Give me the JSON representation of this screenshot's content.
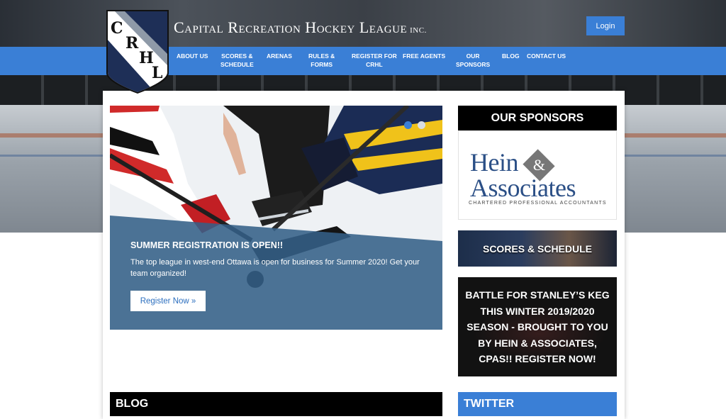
{
  "site": {
    "title": "Capital Recreation Hockey League",
    "title_suffix": "INC.",
    "logo_letters": [
      "C",
      "R",
      "H",
      "L"
    ]
  },
  "header": {
    "login_label": "Login"
  },
  "nav": {
    "items": [
      {
        "line1": "ABOUT US",
        "line2": ""
      },
      {
        "line1": "SCORES &",
        "line2": "SCHEDULE"
      },
      {
        "line1": "ARENAS",
        "line2": ""
      },
      {
        "line1": "RULES &",
        "line2": "FORMS"
      },
      {
        "line1": "REGISTER FOR",
        "line2": "CRHL"
      },
      {
        "line1": "FREE AGENTS",
        "line2": ""
      },
      {
        "line1": "OUR",
        "line2": "SPONSORS"
      },
      {
        "line1": "BLOG",
        "line2": ""
      },
      {
        "line1": "CONTACT US",
        "line2": ""
      }
    ]
  },
  "slider": {
    "heading": "SUMMER REGISTRATION IS OPEN!!",
    "text": "The top league in west-end Ottawa is open for business for Summer 2020! Get your team organized!",
    "button_label": "Register Now »",
    "active_slide": 1,
    "slide_count": 2
  },
  "sidebar": {
    "sponsors_heading": "OUR SPONSORS",
    "sponsor": {
      "name_line1": "Hein",
      "ampersand": "&",
      "name_line2": "Associates",
      "tagline": "CHARTERED PROFESSIONAL ACCOUNTANTS"
    },
    "scores_label": "SCORES & SCHEDULE",
    "battle_label": "BATTLE FOR STANLEY’S KEG THIS WINTER 2019/2020 SEASON - BROUGHT TO YOU BY HEIN & ASSOCIATES, CPAS!! REGISTER NOW!",
    "twitter_heading": "TWITTER"
  },
  "main": {
    "blog_heading": "BLOG"
  },
  "colors": {
    "brand_blue": "#3a7fd6",
    "navy": "#2b4f86",
    "black": "#000000"
  }
}
